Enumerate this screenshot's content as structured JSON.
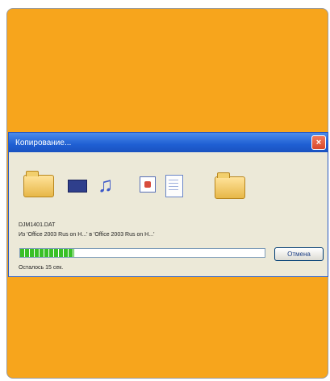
{
  "dialog": {
    "title": "Копирование...",
    "close_label": "×",
    "file_name": "DJM1401.DAT",
    "path_text": "Из 'Office 2003 Rus on H...' в 'Office 2003 Rus on H...'",
    "progress": 0.22,
    "cancel_label": "Отмена",
    "time_left": "Осталось 15 сек.",
    "icons": [
      "folder-icon",
      "movie-icon",
      "music-note-icon",
      "image-icon",
      "document-icon",
      "folder-icon"
    ]
  },
  "colors": {
    "background": "#f7a51c",
    "titlebar": "#1f5fd3",
    "progress_fill": "#39c027"
  }
}
